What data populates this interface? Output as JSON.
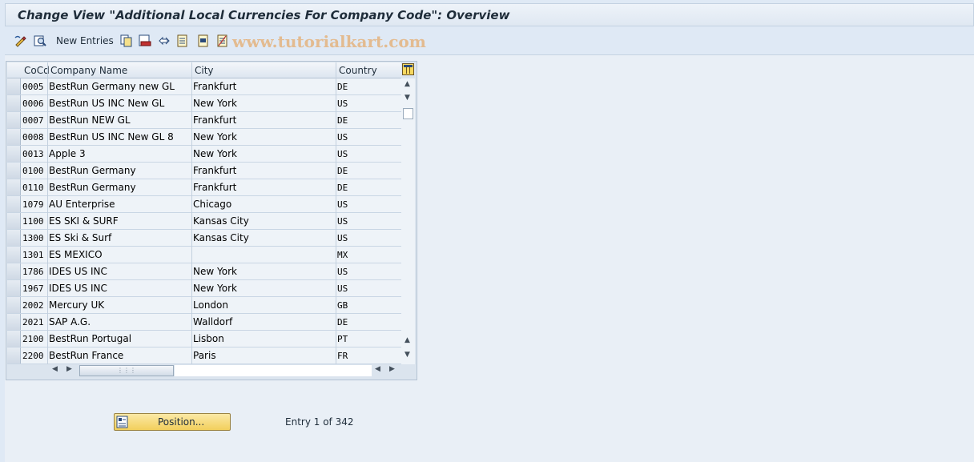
{
  "title": "Change View \"Additional Local Currencies For Company Code\": Overview",
  "toolbar": {
    "new_entries_label": "New Entries"
  },
  "watermark": "www.tutorialkart.com",
  "table": {
    "columns": [
      "CoCd",
      "Company Name",
      "City",
      "Country"
    ],
    "rows": [
      {
        "cocd": "0005",
        "name": "BestRun Germany new GL",
        "city": "Frankfurt",
        "country": "DE"
      },
      {
        "cocd": "0006",
        "name": "BestRun US INC New GL",
        "city": "New York",
        "country": "US"
      },
      {
        "cocd": "0007",
        "name": "BestRun NEW GL",
        "city": "Frankfurt",
        "country": "DE"
      },
      {
        "cocd": "0008",
        "name": "BestRun US INC New GL 8",
        "city": "New York",
        "country": "US"
      },
      {
        "cocd": "0013",
        "name": "Apple 3",
        "city": "New York",
        "country": "US"
      },
      {
        "cocd": "0100",
        "name": "BestRun Germany",
        "city": "Frankfurt",
        "country": "DE"
      },
      {
        "cocd": "0110",
        "name": "BestRun Germany",
        "city": "Frankfurt",
        "country": "DE"
      },
      {
        "cocd": "1079",
        "name": "AU Enterprise",
        "city": "Chicago",
        "country": "US"
      },
      {
        "cocd": "1100",
        "name": "ES SKI & SURF",
        "city": "Kansas City",
        "country": "US"
      },
      {
        "cocd": "1300",
        "name": "ES Ski & Surf",
        "city": "Kansas City",
        "country": "US"
      },
      {
        "cocd": "1301",
        "name": "ES MEXICO",
        "city": "",
        "country": "MX"
      },
      {
        "cocd": "1786",
        "name": "IDES US INC",
        "city": "New York",
        "country": "US"
      },
      {
        "cocd": "1967",
        "name": "IDES US INC",
        "city": "New York",
        "country": "US"
      },
      {
        "cocd": "2002",
        "name": "Mercury UK",
        "city": "London",
        "country": "GB"
      },
      {
        "cocd": "2021",
        "name": "SAP A.G.",
        "city": "Walldorf",
        "country": "DE"
      },
      {
        "cocd": "2100",
        "name": "BestRun Portugal",
        "city": "Lisbon",
        "country": "PT"
      },
      {
        "cocd": "2200",
        "name": "BestRun France",
        "city": "Paris",
        "country": "FR"
      }
    ]
  },
  "footer": {
    "position_label": "Position...",
    "entry_text": "Entry 1 of 342"
  },
  "colors": {
    "background": "#dfe9f5",
    "button_yellow": "#f2cf5c"
  }
}
